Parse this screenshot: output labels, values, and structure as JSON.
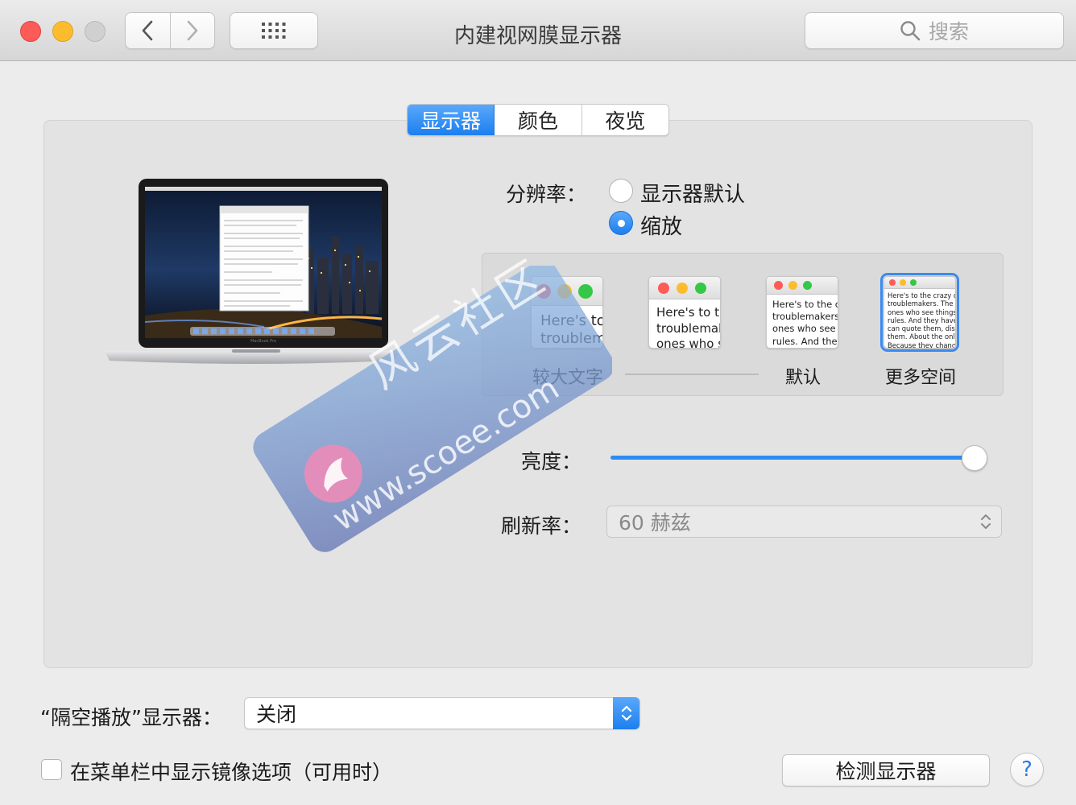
{
  "window": {
    "title": "内建视网膜显示器",
    "search_placeholder": "搜索"
  },
  "tabs": [
    {
      "label": "显示器",
      "active": true
    },
    {
      "label": "颜色",
      "active": false
    },
    {
      "label": "夜览",
      "active": false
    }
  ],
  "resolution": {
    "label": "分辨率：",
    "options": [
      {
        "label": "显示器默认",
        "selected": false
      },
      {
        "label": "缩放",
        "selected": true
      }
    ],
    "scale_options": [
      {
        "label": "较大文字",
        "preview": "Here's to\ntroublem",
        "selected": false
      },
      {
        "label": "",
        "preview": "Here's to th\ntroublemak\nones who s",
        "selected": false
      },
      {
        "label": "默认",
        "preview": "Here's to the cr\ntroublemakers.\nones who see t\nrules. And they",
        "selected": false
      },
      {
        "label": "更多空间",
        "preview": "Here's to the crazy one\ntroublemakers. The rou\nones who see things dif\nrules. And they have no\ncan quote them, disagre\nthem. About the only th\nBecause they change t",
        "selected": true
      }
    ]
  },
  "brightness": {
    "label": "亮度：",
    "level": 0.97
  },
  "refresh": {
    "label": "刷新率：",
    "value": "60 赫兹"
  },
  "airplay": {
    "label": "“隔空播放”显示器：",
    "value": "关闭"
  },
  "mirror_option": {
    "label": "在菜单栏中显示镜像选项（可用时）",
    "checked": false
  },
  "detect_button": "检测显示器",
  "help": "?",
  "laptop_caption": "MacBook Pro",
  "watermark": {
    "cn": "风云社区",
    "url": "www.scoee.com"
  },
  "colors": {
    "accent": "#1c7fef",
    "red": "#fc5b57",
    "yellow": "#fdbc2e",
    "green": "#34c748"
  }
}
